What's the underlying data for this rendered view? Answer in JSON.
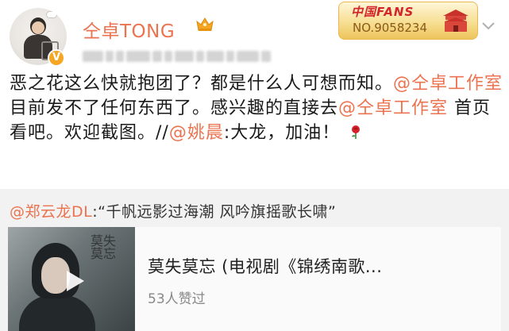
{
  "header": {
    "username": "仝卓TONG",
    "fan_badge": {
      "title": "中国FANS",
      "number": "NO.9058234"
    }
  },
  "post": {
    "text_1": "恶之花这么快就抱团了？都是什么人可想而知。",
    "mention_1": "@仝卓工作室",
    "text_2": "目前发不了任何东西了。感兴趣的直接去",
    "mention_2": "@仝卓工作室",
    "text_3": "首页看吧。欢迎截图。//",
    "mention_3": "@姚晨",
    "text_4": ":大龙，加油！"
  },
  "quote": {
    "mention": "@郑云龙DL",
    "text": ":“千帆远影过海潮  风吟旗摇歌长啸”"
  },
  "card": {
    "title": "莫失莫忘 (电视剧《锦绣南歌...",
    "likes": "53人赞过",
    "thumb_text": "莫失莫忘"
  },
  "colors": {
    "accent": "#eb7350",
    "quote_bg": "#f2f2f2",
    "badge_gold": "#f5a623",
    "fan_red": "#d3262b"
  },
  "icons": [
    "verified-v-icon",
    "crown-icon",
    "chevron-down-icon",
    "rose-icon",
    "play-icon"
  ]
}
